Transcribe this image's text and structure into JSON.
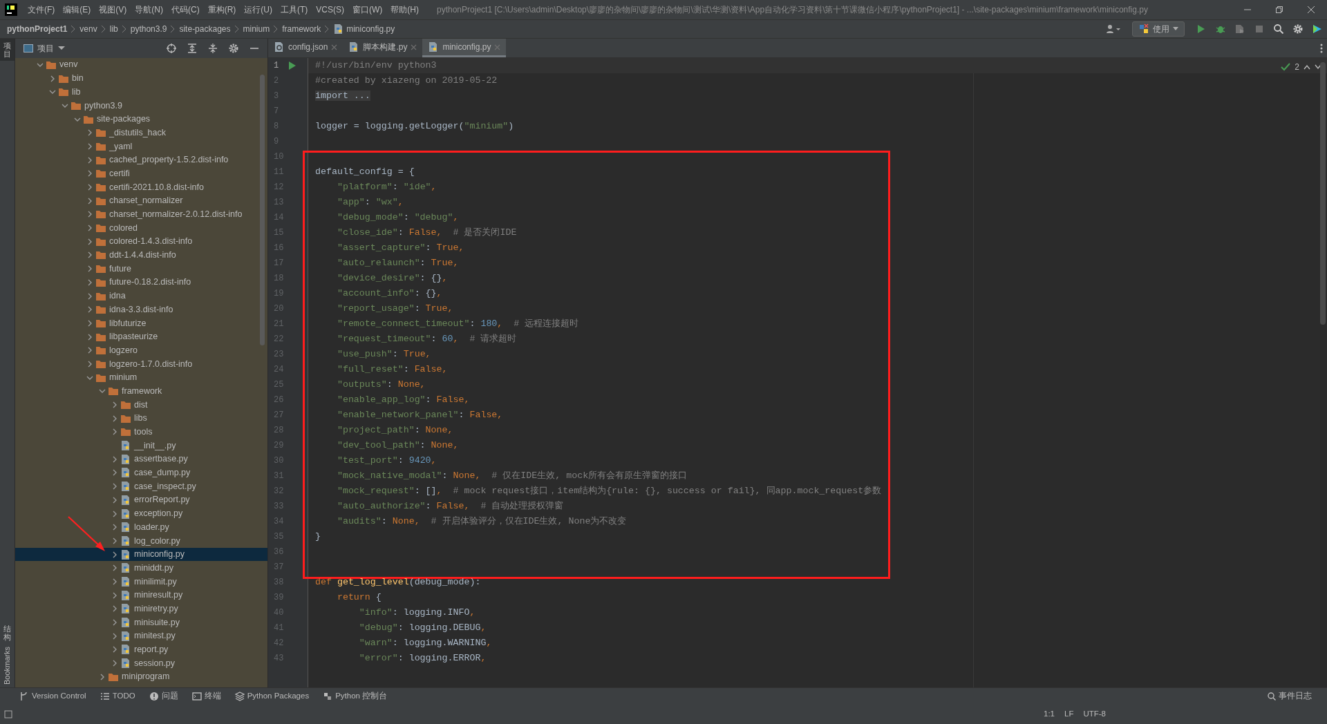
{
  "menu": [
    "文件(F)",
    "编辑(E)",
    "视图(V)",
    "导航(N)",
    "代码(C)",
    "重构(R)",
    "运行(U)",
    "工具(T)",
    "VCS(S)",
    "窗口(W)",
    "帮助(H)"
  ],
  "window_title": "pythonProject1 [C:\\Users\\admin\\Desktop\\廖廖的杂物间\\廖廖的杂物间\\测试\\华测\\资料\\App自动化学习资料\\第十节课微信小程序\\pythonProject1] - ...\\site-packages\\minium\\framework\\miniconfig.py",
  "breadcrumb": [
    {
      "text": "pythonProject1",
      "kind": "project"
    },
    {
      "text": "venv",
      "kind": "folder"
    },
    {
      "text": "lib",
      "kind": "folder"
    },
    {
      "text": "python3.9",
      "kind": "folder"
    },
    {
      "text": "site-packages",
      "kind": "folder"
    },
    {
      "text": "minium",
      "kind": "folder"
    },
    {
      "text": "framework",
      "kind": "folder"
    },
    {
      "text": "miniconfig.py",
      "kind": "python"
    }
  ],
  "run_config": "使用",
  "side_strip": [
    {
      "label": "项目",
      "selected": true
    },
    {
      "label": "结构",
      "selected": false
    },
    {
      "label": "Bookmarks",
      "selected": false
    }
  ],
  "project_panel": {
    "title": "项目",
    "annotation_arrow": true,
    "tree": [
      {
        "name": "venv",
        "kind": "folder",
        "expanded": true,
        "selected": false,
        "children": [
          {
            "name": "bin",
            "kind": "folder",
            "expanded": false,
            "selected": false
          },
          {
            "name": "lib",
            "kind": "folder",
            "expanded": true,
            "selected": false,
            "children": [
              {
                "name": "python3.9",
                "kind": "folder",
                "expanded": true,
                "selected": false,
                "children": [
                  {
                    "name": "site-packages",
                    "kind": "folder",
                    "expanded": true,
                    "selected": false,
                    "children": [
                      {
                        "name": "_distutils_hack",
                        "kind": "folder",
                        "expanded": false,
                        "selected": false
                      },
                      {
                        "name": "_yaml",
                        "kind": "folder",
                        "expanded": false,
                        "selected": false
                      },
                      {
                        "name": "cached_property-1.5.2.dist-info",
                        "kind": "folder",
                        "expanded": false,
                        "selected": false
                      },
                      {
                        "name": "certifi",
                        "kind": "folder",
                        "expanded": false,
                        "selected": false
                      },
                      {
                        "name": "certifi-2021.10.8.dist-info",
                        "kind": "folder",
                        "expanded": false,
                        "selected": false
                      },
                      {
                        "name": "charset_normalizer",
                        "kind": "folder",
                        "expanded": false,
                        "selected": false
                      },
                      {
                        "name": "charset_normalizer-2.0.12.dist-info",
                        "kind": "folder",
                        "expanded": false,
                        "selected": false
                      },
                      {
                        "name": "colored",
                        "kind": "folder",
                        "expanded": false,
                        "selected": false
                      },
                      {
                        "name": "colored-1.4.3.dist-info",
                        "kind": "folder",
                        "expanded": false,
                        "selected": false
                      },
                      {
                        "name": "ddt-1.4.4.dist-info",
                        "kind": "folder",
                        "expanded": false,
                        "selected": false
                      },
                      {
                        "name": "future",
                        "kind": "folder",
                        "expanded": false,
                        "selected": false
                      },
                      {
                        "name": "future-0.18.2.dist-info",
                        "kind": "folder",
                        "expanded": false,
                        "selected": false
                      },
                      {
                        "name": "idna",
                        "kind": "folder",
                        "expanded": false,
                        "selected": false
                      },
                      {
                        "name": "idna-3.3.dist-info",
                        "kind": "folder",
                        "expanded": false,
                        "selected": false
                      },
                      {
                        "name": "libfuturize",
                        "kind": "folder",
                        "expanded": false,
                        "selected": false
                      },
                      {
                        "name": "libpasteurize",
                        "kind": "folder",
                        "expanded": false,
                        "selected": false
                      },
                      {
                        "name": "logzero",
                        "kind": "folder",
                        "expanded": false,
                        "selected": false
                      },
                      {
                        "name": "logzero-1.7.0.dist-info",
                        "kind": "folder",
                        "expanded": false,
                        "selected": false
                      },
                      {
                        "name": "minium",
                        "kind": "folder",
                        "expanded": true,
                        "selected": false,
                        "children": [
                          {
                            "name": "framework",
                            "kind": "folder",
                            "expanded": true,
                            "selected": false,
                            "children": [
                              {
                                "name": "dist",
                                "kind": "folder",
                                "expanded": false,
                                "selected": false
                              },
                              {
                                "name": "libs",
                                "kind": "folder",
                                "expanded": false,
                                "selected": false
                              },
                              {
                                "name": "tools",
                                "kind": "folder",
                                "expanded": false,
                                "selected": false
                              },
                              {
                                "name": "__init__.py",
                                "kind": "python",
                                "selected": false
                              },
                              {
                                "name": "assertbase.py",
                                "kind": "python",
                                "expanded": false,
                                "selected": false
                              },
                              {
                                "name": "case_dump.py",
                                "kind": "python",
                                "expanded": false,
                                "selected": false
                              },
                              {
                                "name": "case_inspect.py",
                                "kind": "python",
                                "expanded": false,
                                "selected": false
                              },
                              {
                                "name": "errorReport.py",
                                "kind": "python",
                                "expanded": false,
                                "selected": false
                              },
                              {
                                "name": "exception.py",
                                "kind": "python",
                                "expanded": false,
                                "selected": false
                              },
                              {
                                "name": "loader.py",
                                "kind": "python",
                                "expanded": false,
                                "selected": false
                              },
                              {
                                "name": "log_color.py",
                                "kind": "python",
                                "expanded": false,
                                "selected": false
                              },
                              {
                                "name": "miniconfig.py",
                                "kind": "python",
                                "expanded": false,
                                "selected": true
                              },
                              {
                                "name": "miniddt.py",
                                "kind": "python",
                                "expanded": false,
                                "selected": false
                              },
                              {
                                "name": "minilimit.py",
                                "kind": "python",
                                "expanded": false,
                                "selected": false
                              },
                              {
                                "name": "miniresult.py",
                                "kind": "python",
                                "expanded": false,
                                "selected": false
                              },
                              {
                                "name": "miniretry.py",
                                "kind": "python",
                                "expanded": false,
                                "selected": false
                              },
                              {
                                "name": "minisuite.py",
                                "kind": "python",
                                "expanded": false,
                                "selected": false
                              },
                              {
                                "name": "minitest.py",
                                "kind": "python",
                                "expanded": false,
                                "selected": false
                              },
                              {
                                "name": "report.py",
                                "kind": "python",
                                "expanded": false,
                                "selected": false
                              },
                              {
                                "name": "session.py",
                                "kind": "python",
                                "expanded": false,
                                "selected": false
                              }
                            ]
                          },
                          {
                            "name": "miniprogram",
                            "kind": "folder",
                            "expanded": false,
                            "selected": false
                          }
                        ]
                      }
                    ]
                  }
                ]
              }
            ]
          }
        ]
      }
    ]
  },
  "tabs": [
    {
      "label": "config.json",
      "kind": "json",
      "selected": false
    },
    {
      "label": "脚本构建.py",
      "kind": "python",
      "selected": false
    },
    {
      "label": "miniconfig.py",
      "kind": "python",
      "selected": true
    }
  ],
  "editor": {
    "problems": "2",
    "sections": [
      {
        "kind": "plain",
        "lines": [
          {
            "number": "1",
            "tokens": [
              {
                "kind": "comment",
                "text": "#!/usr/bin/env python3"
              }
            ]
          },
          {
            "number": "2",
            "tokens": [
              {
                "kind": "comment",
                "text": "#created by xiazeng on 2019-05-22"
              }
            ]
          },
          {
            "number": "3",
            "tokens": [
              {
                "kind": "folded",
                "text": "import ..."
              }
            ]
          },
          {
            "number": "7"
          },
          {
            "number": "8",
            "tokens": [
              {
                "kind": "plain",
                "text": "logger = logging.getLogger("
              },
              {
                "kind": "string",
                "text": "\"minium\""
              },
              {
                "kind": "plain",
                "text": ")"
              }
            ]
          },
          {
            "number": "9"
          }
        ]
      },
      {
        "kind": "annotated",
        "lines": [
          {
            "number": "10"
          },
          {
            "number": "11",
            "tokens": [
              {
                "kind": "plain",
                "text": "default_config = {"
              }
            ]
          },
          {
            "number": "12",
            "tokens": [
              {
                "kind": "string",
                "text": "    \"platform\""
              },
              {
                "kind": "plain",
                "text": ": "
              },
              {
                "kind": "string",
                "text": "\"ide\""
              },
              {
                "kind": "keyword",
                "text": ","
              }
            ]
          },
          {
            "number": "13",
            "tokens": [
              {
                "kind": "string",
                "text": "    \"app\""
              },
              {
                "kind": "plain",
                "text": ": "
              },
              {
                "kind": "string",
                "text": "\"wx\""
              },
              {
                "kind": "keyword",
                "text": ","
              }
            ]
          },
          {
            "number": "14",
            "tokens": [
              {
                "kind": "string",
                "text": "    \"debug_mode\""
              },
              {
                "kind": "plain",
                "text": ": "
              },
              {
                "kind": "string",
                "text": "\"debug\""
              },
              {
                "kind": "keyword",
                "text": ","
              }
            ]
          },
          {
            "number": "15",
            "tokens": [
              {
                "kind": "string",
                "text": "    \"close_ide\""
              },
              {
                "kind": "plain",
                "text": ": "
              },
              {
                "kind": "keyword",
                "text": "False,"
              },
              {
                "kind": "comment",
                "text": "  # 是否关闭IDE"
              }
            ]
          },
          {
            "number": "16",
            "tokens": [
              {
                "kind": "string",
                "text": "    \"assert_capture\""
              },
              {
                "kind": "plain",
                "text": ": "
              },
              {
                "kind": "keyword",
                "text": "True,"
              }
            ]
          },
          {
            "number": "17",
            "tokens": [
              {
                "kind": "string",
                "text": "    \"auto_relaunch\""
              },
              {
                "kind": "plain",
                "text": ": "
              },
              {
                "kind": "keyword",
                "text": "True,"
              }
            ]
          },
          {
            "number": "18",
            "tokens": [
              {
                "kind": "string",
                "text": "    \"device_desire\""
              },
              {
                "kind": "plain",
                "text": ": {}"
              },
              {
                "kind": "keyword",
                "text": ","
              }
            ]
          },
          {
            "number": "19",
            "tokens": [
              {
                "kind": "string",
                "text": "    \"account_info\""
              },
              {
                "kind": "plain",
                "text": ": {}"
              },
              {
                "kind": "keyword",
                "text": ","
              }
            ]
          },
          {
            "number": "20",
            "tokens": [
              {
                "kind": "string",
                "text": "    \"report_usage\""
              },
              {
                "kind": "plain",
                "text": ": "
              },
              {
                "kind": "keyword",
                "text": "True,"
              }
            ]
          },
          {
            "number": "21",
            "tokens": [
              {
                "kind": "string",
                "text": "    \"remote_connect_timeout\""
              },
              {
                "kind": "plain",
                "text": ": "
              },
              {
                "kind": "number",
                "text": "180"
              },
              {
                "kind": "keyword",
                "text": ","
              },
              {
                "kind": "comment",
                "text": "  # 远程连接超时"
              }
            ]
          },
          {
            "number": "22",
            "tokens": [
              {
                "kind": "string",
                "text": "    \"request_timeout\""
              },
              {
                "kind": "plain",
                "text": ": "
              },
              {
                "kind": "number",
                "text": "60"
              },
              {
                "kind": "keyword",
                "text": ","
              },
              {
                "kind": "comment",
                "text": "  # 请求超时"
              }
            ]
          },
          {
            "number": "23",
            "tokens": [
              {
                "kind": "string",
                "text": "    \"use_push\""
              },
              {
                "kind": "plain",
                "text": ": "
              },
              {
                "kind": "keyword",
                "text": "True,"
              }
            ]
          },
          {
            "number": "24",
            "tokens": [
              {
                "kind": "string",
                "text": "    \"full_reset\""
              },
              {
                "kind": "plain",
                "text": ": "
              },
              {
                "kind": "keyword",
                "text": "False,"
              }
            ]
          },
          {
            "number": "25",
            "tokens": [
              {
                "kind": "string",
                "text": "    \"outputs\""
              },
              {
                "kind": "plain",
                "text": ": "
              },
              {
                "kind": "keyword",
                "text": "None,"
              }
            ]
          },
          {
            "number": "26",
            "tokens": [
              {
                "kind": "string",
                "text": "    \"enable_app_log\""
              },
              {
                "kind": "plain",
                "text": ": "
              },
              {
                "kind": "keyword",
                "text": "False,"
              }
            ]
          },
          {
            "number": "27",
            "tokens": [
              {
                "kind": "string",
                "text": "    \"enable_network_panel\""
              },
              {
                "kind": "plain",
                "text": ": "
              },
              {
                "kind": "keyword",
                "text": "False,"
              }
            ]
          },
          {
            "number": "28",
            "tokens": [
              {
                "kind": "string",
                "text": "    \"project_path\""
              },
              {
                "kind": "plain",
                "text": ": "
              },
              {
                "kind": "keyword",
                "text": "None,"
              }
            ]
          },
          {
            "number": "29",
            "tokens": [
              {
                "kind": "string",
                "text": "    \"dev_tool_path\""
              },
              {
                "kind": "plain",
                "text": ": "
              },
              {
                "kind": "keyword",
                "text": "None,"
              }
            ]
          },
          {
            "number": "30",
            "tokens": [
              {
                "kind": "string",
                "text": "    \"test_port\""
              },
              {
                "kind": "plain",
                "text": ": "
              },
              {
                "kind": "number",
                "text": "9420"
              },
              {
                "kind": "keyword",
                "text": ","
              }
            ]
          },
          {
            "number": "31",
            "tokens": [
              {
                "kind": "string",
                "text": "    \"mock_native_modal\""
              },
              {
                "kind": "plain",
                "text": ": "
              },
              {
                "kind": "keyword",
                "text": "None,"
              },
              {
                "kind": "comment",
                "text": "  # 仅在IDE生效, mock所有会有原生弹窗的接口"
              }
            ]
          },
          {
            "number": "32",
            "tokens": [
              {
                "kind": "string",
                "text": "    \"mock_request\""
              },
              {
                "kind": "plain",
                "text": ": []"
              },
              {
                "kind": "keyword",
                "text": ","
              },
              {
                "kind": "comment",
                "text": "  # mock request接口，item结构为{rule: {}, success or fail}, 同app.mock_request参数"
              }
            ]
          },
          {
            "number": "33",
            "tokens": [
              {
                "kind": "string",
                "text": "    \"auto_authorize\""
              },
              {
                "kind": "plain",
                "text": ": "
              },
              {
                "kind": "keyword",
                "text": "False,"
              },
              {
                "kind": "comment",
                "text": "  # 自动处理授权弹窗"
              }
            ]
          },
          {
            "number": "34",
            "tokens": [
              {
                "kind": "string",
                "text": "    \"audits\""
              },
              {
                "kind": "plain",
                "text": ": "
              },
              {
                "kind": "keyword",
                "text": "None,"
              },
              {
                "kind": "comment",
                "text": "  # 开启体验评分，仅在IDE生效, None为不改变"
              }
            ]
          },
          {
            "number": "35",
            "tokens": [
              {
                "kind": "plain",
                "text": "}"
              }
            ]
          },
          {
            "number": "36"
          },
          {
            "number": "37"
          }
        ]
      },
      {
        "kind": "plain",
        "lines": [
          {
            "number": "38",
            "tokens": [
              {
                "kind": "keyword",
                "text": "def "
              },
              {
                "kind": "function",
                "text": "get_log_level"
              },
              {
                "kind": "plain",
                "text": "(debug_mode):"
              }
            ]
          },
          {
            "number": "39",
            "tokens": [
              {
                "kind": "keyword",
                "text": "    return"
              },
              {
                "kind": "plain",
                "text": " {"
              }
            ]
          },
          {
            "number": "40",
            "tokens": [
              {
                "kind": "string",
                "text": "        \"info\""
              },
              {
                "kind": "plain",
                "text": ": logging.INFO"
              },
              {
                "kind": "keyword",
                "text": ","
              }
            ]
          },
          {
            "number": "41",
            "tokens": [
              {
                "kind": "string",
                "text": "        \"debug\""
              },
              {
                "kind": "plain",
                "text": ": logging.DEBUG"
              },
              {
                "kind": "keyword",
                "text": ","
              }
            ]
          },
          {
            "number": "42",
            "tokens": [
              {
                "kind": "string",
                "text": "        \"warn\""
              },
              {
                "kind": "plain",
                "text": ": logging.WARNING"
              },
              {
                "kind": "keyword",
                "text": ","
              }
            ]
          },
          {
            "number": "43",
            "tokens": [
              {
                "kind": "string",
                "text": "        \"error\""
              },
              {
                "kind": "plain",
                "text": ": logging.ERROR"
              },
              {
                "kind": "keyword",
                "text": ","
              }
            ]
          }
        ]
      }
    ]
  },
  "tool_windows": [
    "Version Control",
    "TODO",
    "问题",
    "终端",
    "Python Packages",
    "Python 控制台"
  ],
  "event_log": "事件日志",
  "status_bar": [
    "1:1",
    "LF",
    "UTF-8"
  ]
}
